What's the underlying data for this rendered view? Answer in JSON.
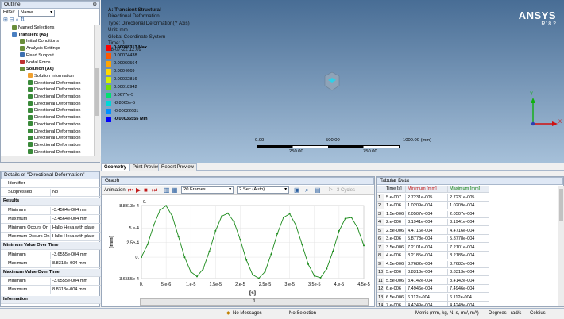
{
  "outline": {
    "title": "Outline",
    "filter_label": "Filter:",
    "filter_value": "Name",
    "tree": [
      {
        "label": "Named Selections",
        "indent": 0,
        "icon": "named-selection-icon",
        "color": "#6a8e3a"
      },
      {
        "label": "Transient (A5)",
        "indent": 0,
        "icon": "transient-icon",
        "color": "#4a7fc1",
        "bold": true
      },
      {
        "label": "Initial Conditions",
        "indent": 1,
        "icon": "initial-conditions-icon",
        "color": "#6a8e3a"
      },
      {
        "label": "Analysis Settings",
        "indent": 1,
        "icon": "analysis-settings-icon",
        "color": "#6a8e3a"
      },
      {
        "label": "Fixed Support",
        "indent": 1,
        "icon": "fixed-support-icon",
        "color": "#3c6fb0"
      },
      {
        "label": "Nodal Force",
        "indent": 1,
        "icon": "nodal-force-icon",
        "color": "#c03030"
      },
      {
        "label": "Solution (A6)",
        "indent": 1,
        "icon": "solution-icon",
        "color": "#6a8e3a",
        "bold": true
      },
      {
        "label": "Solution Information",
        "indent": 2,
        "icon": "solution-information-icon",
        "color": "#f0a030"
      },
      {
        "label": "Directional Deformation",
        "indent": 2,
        "icon": "result-icon",
        "color": "#3a8a3a"
      },
      {
        "label": "Directional Deformation",
        "indent": 2,
        "icon": "result-icon",
        "color": "#3a8a3a"
      },
      {
        "label": "Directional Deformation",
        "indent": 2,
        "icon": "result-icon",
        "color": "#3a8a3a"
      },
      {
        "label": "Directional Deformation",
        "indent": 2,
        "icon": "result-icon",
        "color": "#3a8a3a"
      },
      {
        "label": "Directional Deformation",
        "indent": 2,
        "icon": "result-icon",
        "color": "#3a8a3a"
      },
      {
        "label": "Directional Deformation",
        "indent": 2,
        "icon": "result-icon",
        "color": "#3a8a3a"
      },
      {
        "label": "Directional Deformation",
        "indent": 2,
        "icon": "result-icon",
        "color": "#3a8a3a"
      },
      {
        "label": "Directional Deformation",
        "indent": 2,
        "icon": "result-icon",
        "color": "#3a8a3a"
      },
      {
        "label": "Directional Deformation",
        "indent": 2,
        "icon": "result-icon",
        "color": "#3a8a3a"
      },
      {
        "label": "Directional Deformation",
        "indent": 2,
        "icon": "result-icon",
        "color": "#3a8a3a"
      },
      {
        "label": "Directional Deformation",
        "indent": 2,
        "icon": "result-icon",
        "color": "#3a8a3a"
      }
    ]
  },
  "viewport": {
    "info": [
      "A: Transient Structural",
      "Directional Deformation",
      "Type: Directional Deformation(Y Axis)",
      "Unit: mm",
      "Global Coordinate System",
      "Time: 0",
      "28-07-22 12:09"
    ],
    "brand": "ANSYS",
    "version": "R18.2",
    "legend": [
      {
        "label": "0.00088313 Max",
        "color": "#ff0000",
        "bold": true
      },
      {
        "label": "0.00074438",
        "color": "#ff5a00"
      },
      {
        "label": "0.00060564",
        "color": "#ffa500"
      },
      {
        "label": "0.0004669",
        "color": "#ffd800"
      },
      {
        "label": "0.00032816",
        "color": "#d8f000"
      },
      {
        "label": "0.00018942",
        "color": "#70e000"
      },
      {
        "label": "5.0677e-5",
        "color": "#00e070"
      },
      {
        "label": "-8.8065e-5",
        "color": "#00d8d8"
      },
      {
        "label": "-0.00022681",
        "color": "#0090ff"
      },
      {
        "label": "-0.00036555 Min",
        "color": "#0000ff",
        "bold": true
      }
    ],
    "scale": {
      "t0": "0.00",
      "t1": "500.00",
      "t2": "1000.00 (mm)",
      "b1": "250.00",
      "b2": "750.00"
    },
    "axis_x": "X",
    "axis_y": "Y"
  },
  "tabs": [
    "Geometry",
    "Print Preview",
    "Report Preview"
  ],
  "details": {
    "title": "Details of \"Directional Deformation\"",
    "rows": [
      {
        "k": "Identifier",
        "v": ""
      },
      {
        "k": "Suppressed",
        "v": "No"
      },
      {
        "group": "Results"
      },
      {
        "k": "Minimum",
        "v": "-3.4564e-004 mm"
      },
      {
        "k": "Maximum",
        "v": "-3.4564e-004 mm"
      },
      {
        "k": "Minimum Occurs On",
        "v": "Hallo Hexa with plate"
      },
      {
        "k": "Maximum Occurs On",
        "v": "Hallo Hexa with plate"
      },
      {
        "group": "Minimum Value Over Time"
      },
      {
        "k": "Minimum",
        "v": "-3.6555e-004 mm"
      },
      {
        "k": "Maximum",
        "v": "8.8313e-004 mm"
      },
      {
        "group": "Maximum Value Over Time"
      },
      {
        "k": "Minimum",
        "v": "-3.6555e-004 mm"
      },
      {
        "k": "Maximum",
        "v": "8.8313e-004 mm"
      },
      {
        "group": "Information"
      }
    ]
  },
  "graph": {
    "title": "Graph",
    "animation_label": "Animation",
    "frames": "20 Frames",
    "duration": "2 Sec (Auto)",
    "cycles": "3 Cycles",
    "bottom_bar": "1"
  },
  "chart_data": {
    "type": "line",
    "title": "",
    "xlabel": "[s]",
    "ylabel": "[mm]",
    "xlim": [
      0,
      4.5e-05
    ],
    "ylim": [
      -0.00036555,
      0.00088313
    ],
    "x_ticks": [
      "0.",
      "5.e-6",
      "1.e-5",
      "1.5e-5",
      "2.e-5",
      "2.5e-5",
      "3.e-5",
      "3.5e-5",
      "4.e-5",
      "4.5e-5"
    ],
    "y_ticks": [
      "8.8313e-4",
      "5.e-4",
      "2.5e-4",
      "0.",
      "-3.6555e-4"
    ],
    "y_top_label": "0.",
    "series": [
      {
        "x": [
          0,
          1.25e-06,
          2.5e-06,
          3.75e-06,
          5e-06,
          6.25e-06,
          7.5e-06,
          8.75e-06,
          1e-05,
          1.125e-05,
          1.25e-05,
          1.375e-05,
          1.5e-05,
          1.625e-05,
          1.75e-05,
          1.875e-05,
          2e-05,
          2.125e-05,
          2.25e-05,
          2.375e-05,
          2.5e-05,
          2.625e-05,
          2.75e-05,
          2.875e-05,
          3e-05,
          3.125e-05,
          3.25e-05,
          3.375e-05,
          3.5e-05,
          3.625e-05,
          3.75e-05,
          3.875e-05,
          4e-05,
          4.125e-05,
          4.25e-05,
          4.375e-05,
          4.5e-05
        ],
        "y": [
          0,
          0.00022,
          0.00055,
          0.0008,
          0.00088,
          0.0007,
          0.00035,
          0.0,
          -0.00025,
          -0.00033,
          -0.0002,
          0.0001,
          0.00045,
          0.0007,
          0.00075,
          0.0006,
          0.0003,
          -5e-05,
          -0.0003,
          -0.00036,
          -0.00025,
          5e-05,
          0.0004,
          0.00068,
          0.00074,
          0.00055,
          0.00022,
          -0.00012,
          -0.00032,
          -0.00035,
          -0.0002,
          0.0001,
          0.00045,
          0.00066,
          0.00068,
          0.0005,
          0.0002
        ]
      }
    ],
    "grid": true,
    "legend": "none"
  },
  "tabular": {
    "title": "Tabular Data",
    "headers": [
      "",
      "Time [s]",
      "Minimum [mm]",
      "Maximum [mm]"
    ],
    "rows": [
      [
        "1",
        "5.e-007",
        "2.7231e-005",
        "2.7231e-005"
      ],
      [
        "2",
        "1.e-006",
        "1.0209e-004",
        "1.0209e-004"
      ],
      [
        "3",
        "1.5e-006",
        "2.0507e-004",
        "2.0507e-004"
      ],
      [
        "4",
        "2.e-006",
        "3.1941e-004",
        "3.1941e-004"
      ],
      [
        "5",
        "2.5e-006",
        "4.4716e-004",
        "4.4716e-004"
      ],
      [
        "6",
        "3.e-006",
        "5.8778e-004",
        "5.8778e-004"
      ],
      [
        "7",
        "3.5e-006",
        "7.2101e-004",
        "7.2101e-004"
      ],
      [
        "8",
        "4.e-006",
        "8.2185e-004",
        "8.2185e-004"
      ],
      [
        "9",
        "4.5e-006",
        "8.7682e-004",
        "8.7682e-004"
      ],
      [
        "10",
        "5.e-006",
        "8.8313e-004",
        "8.8313e-004"
      ],
      [
        "11",
        "5.5e-006",
        "8.4142e-004",
        "8.4142e-004"
      ],
      [
        "12",
        "6.e-006",
        "7.4946e-004",
        "7.4946e-004"
      ],
      [
        "13",
        "6.5e-006",
        "6.112e-004",
        "6.112e-004"
      ],
      [
        "14",
        "7.e-006",
        "4.4249e-004",
        "4.4249e-004"
      ]
    ]
  },
  "status": {
    "messages": "No Messages",
    "selection": "No Selection",
    "units": "Metric (mm, kg, N, s, mV, mA)",
    "angle": "Degrees",
    "rot": "rad/s",
    "temp": "Celsius"
  }
}
